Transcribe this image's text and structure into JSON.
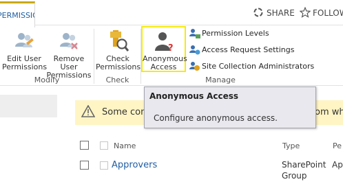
{
  "tab": {
    "label": "PERMISSIONS"
  },
  "topbar": {
    "share_label": "SHARE",
    "follow_label": "FOLLOW"
  },
  "ribbon": {
    "groups": [
      {
        "name": "Modify",
        "buttons": [
          {
            "line1": "Edit User",
            "line2": "Permissions"
          },
          {
            "line1": "Remove User",
            "line2": "Permissions"
          }
        ]
      },
      {
        "name": "Check",
        "buttons": [
          {
            "line1": "Check",
            "line2": "Permissions"
          }
        ]
      },
      {
        "name": "Manage",
        "buttons": [
          {
            "line1": "Anonymous",
            "line2": "Access"
          }
        ],
        "small_buttons": [
          {
            "label": "Permission Levels",
            "icon": "permission-levels-icon"
          },
          {
            "label": "Access Request Settings",
            "icon": "access-request-icon"
          },
          {
            "label": "Site Collection Administrators",
            "icon": "site-admins-icon"
          }
        ]
      }
    ],
    "highlight_color": "#f5eb0e"
  },
  "tooltip": {
    "title": "Anonymous Access",
    "body": "Configure anonymous access."
  },
  "warning": {
    "text_start": "Some cont",
    "text_end": "om wha"
  },
  "table": {
    "headers": [
      "Name",
      "Type",
      "Pe"
    ],
    "rows": [
      {
        "name": "Approvers",
        "type_line1": "SharePoint",
        "type_line2": "Group",
        "perm": "Ap"
      }
    ]
  }
}
